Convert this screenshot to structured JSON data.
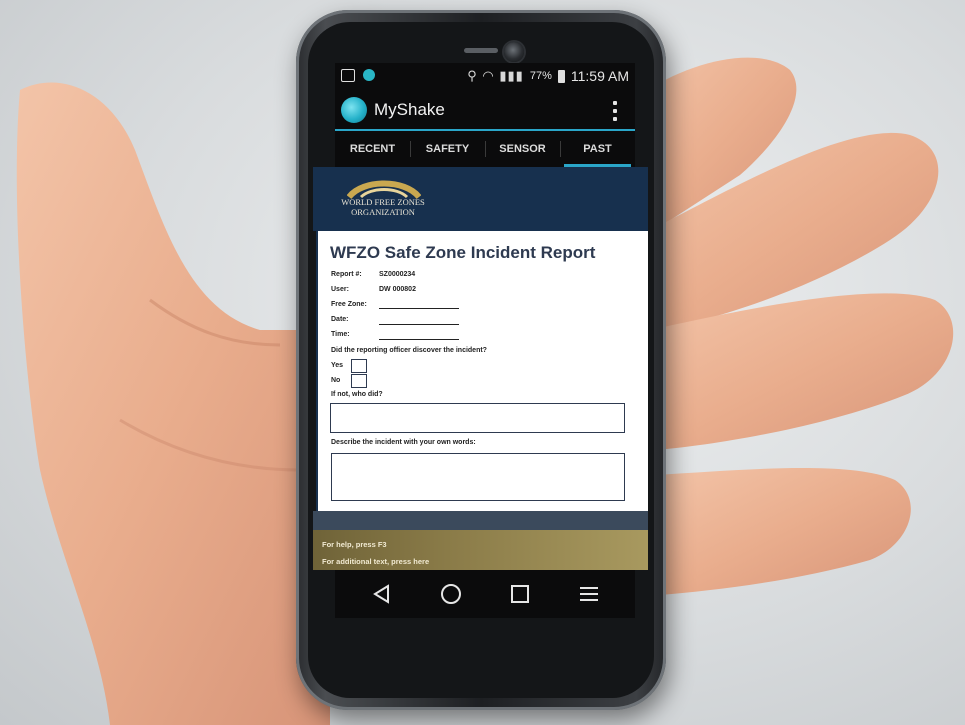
{
  "status_bar": {
    "battery": "77%",
    "time": "11:59 AM"
  },
  "app": {
    "title": "MyShake"
  },
  "tabs": [
    {
      "label": "RECENT",
      "active": false
    },
    {
      "label": "SAFETY",
      "active": false
    },
    {
      "label": "SENSOR",
      "active": false
    },
    {
      "label": "PAST",
      "active": true
    }
  ],
  "banner": {
    "org_line1": "WORLD FREE ZONES",
    "org_line2": "ORGANIZATION"
  },
  "form": {
    "title": "WFZO Safe Zone Incident Report",
    "report_label": "Report #:",
    "report_value": "SZ0000234",
    "user_label": "User:",
    "user_value": "DW 000802",
    "free_zone_label": "Free Zone:",
    "date_label": "Date:",
    "time_label": "Time:",
    "question": "Did the reporting officer discover the incident?",
    "yes_label": "Yes",
    "no_label": "No",
    "who_label": "If not, who did?",
    "describe_label": "Describe the incident with your own words:"
  },
  "footer": {
    "help": "For help, press F3",
    "additional": "For additional text, press here"
  },
  "colors": {
    "accent": "#2aa6c9",
    "banner": "#17304e",
    "gold": "#8a7b48",
    "title": "#2e3a50"
  },
  "nav_icons": [
    "back-icon",
    "home-icon",
    "recents-icon",
    "menu-icon"
  ]
}
